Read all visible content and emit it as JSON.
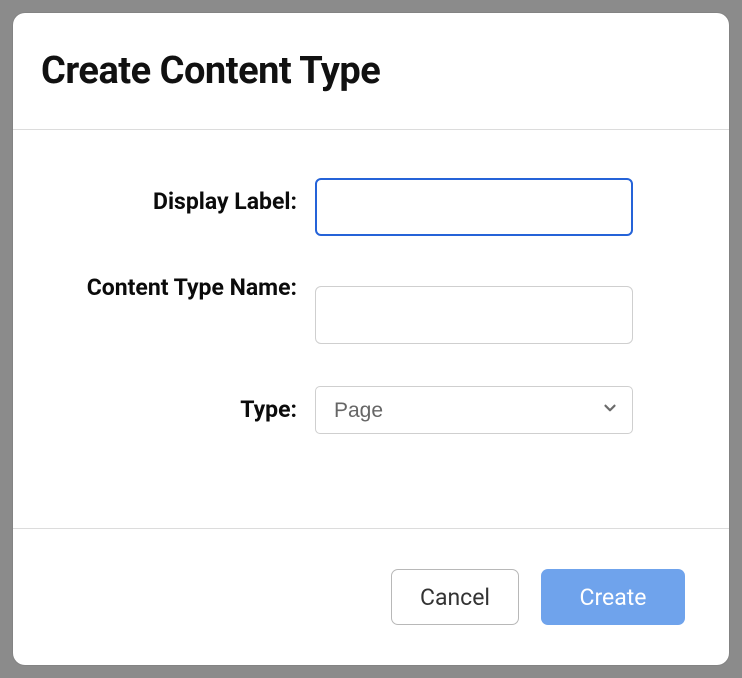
{
  "dialog": {
    "title": "Create Content Type"
  },
  "form": {
    "displayLabel": {
      "label": "Display Label:",
      "value": ""
    },
    "contentTypeName": {
      "label": "Content Type Name:",
      "value": ""
    },
    "type": {
      "label": "Type:",
      "selected": "Page"
    }
  },
  "footer": {
    "cancel": "Cancel",
    "create": "Create"
  }
}
